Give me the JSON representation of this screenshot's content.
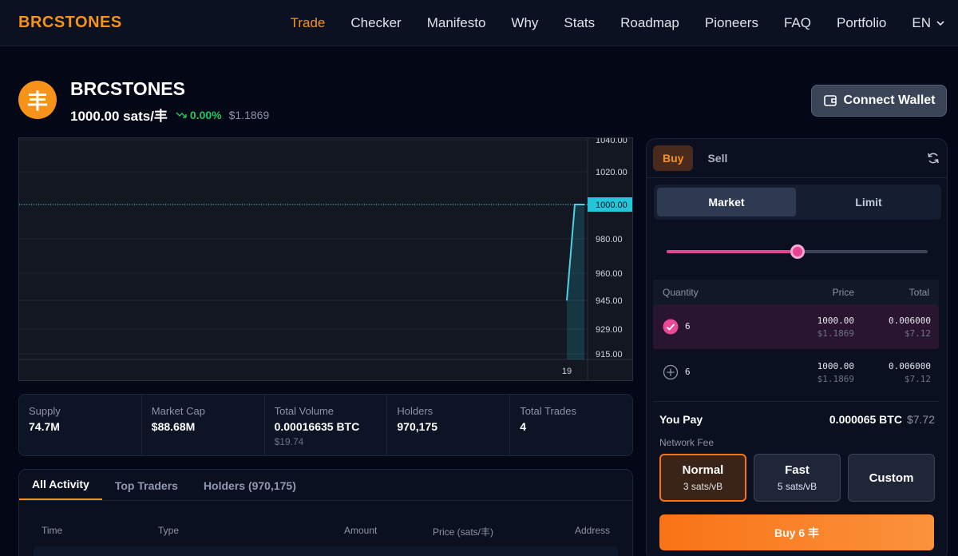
{
  "brand": "BRCSTONES",
  "nav": {
    "items": [
      "Trade",
      "Checker",
      "Manifesto",
      "Why",
      "Stats",
      "Roadmap",
      "Pioneers",
      "FAQ",
      "Portfolio"
    ],
    "lang": "EN"
  },
  "token": {
    "logo_glyph": "丰",
    "name": "BRCSTONES",
    "price": "1000.00 sats/丰",
    "change": "0.00%",
    "usd": "$1.1869"
  },
  "connect_wallet": "Connect Wallet",
  "chart_data": {
    "type": "line",
    "y_ticks": [
      "1040.00",
      "1020.00",
      "1000.00",
      "980.00",
      "960.00",
      "945.00",
      "929.00",
      "915.00"
    ],
    "x_ticks": [
      "19"
    ],
    "last_price_label": "1000.00",
    "series": [
      {
        "values": [
          945,
          1000,
          1000
        ]
      }
    ],
    "colors": {
      "line": "#4dd0e1",
      "price_tag": "#26c6da"
    }
  },
  "stats": [
    {
      "label": "Supply",
      "value": "74.7M",
      "sub": ""
    },
    {
      "label": "Market Cap",
      "value": "$88.68M",
      "sub": ""
    },
    {
      "label": "Total Volume",
      "value": "0.00016635 BTC",
      "sub": "$19.74"
    },
    {
      "label": "Holders",
      "value": "970,175",
      "sub": ""
    },
    {
      "label": "Total Trades",
      "value": "4",
      "sub": ""
    }
  ],
  "activity": {
    "tabs": [
      "All Activity",
      "Top Traders",
      "Holders (970,175)"
    ],
    "columns": [
      "Time",
      "Type",
      "Amount",
      "Price (sats/丰)",
      "Address"
    ]
  },
  "trade": {
    "buy": "Buy",
    "sell": "Sell",
    "modes": [
      "Market",
      "Limit"
    ],
    "slider_level": 0.5,
    "headers": {
      "quantity": "Quantity",
      "price": "Price",
      "total": "Total"
    },
    "rows": [
      {
        "qty": "6",
        "price": "1000.00",
        "price_usd": "$1.1869",
        "total": "0.006000",
        "total_usd": "$7.12",
        "selected": true
      },
      {
        "qty": "6",
        "price": "1000.00",
        "price_usd": "$1.1869",
        "total": "0.006000",
        "total_usd": "$7.12",
        "selected": false
      }
    ],
    "you_pay_label": "You Pay",
    "you_pay_btc": "0.000065 BTC",
    "you_pay_usd": "$7.72",
    "network_fee_label": "Network Fee",
    "fees": [
      {
        "name": "Normal",
        "rate": "3 sats/vB"
      },
      {
        "name": "Fast",
        "rate": "5 sats/vB"
      },
      {
        "name": "Custom",
        "rate": ""
      }
    ],
    "buy_button": "Buy 6 丰"
  }
}
